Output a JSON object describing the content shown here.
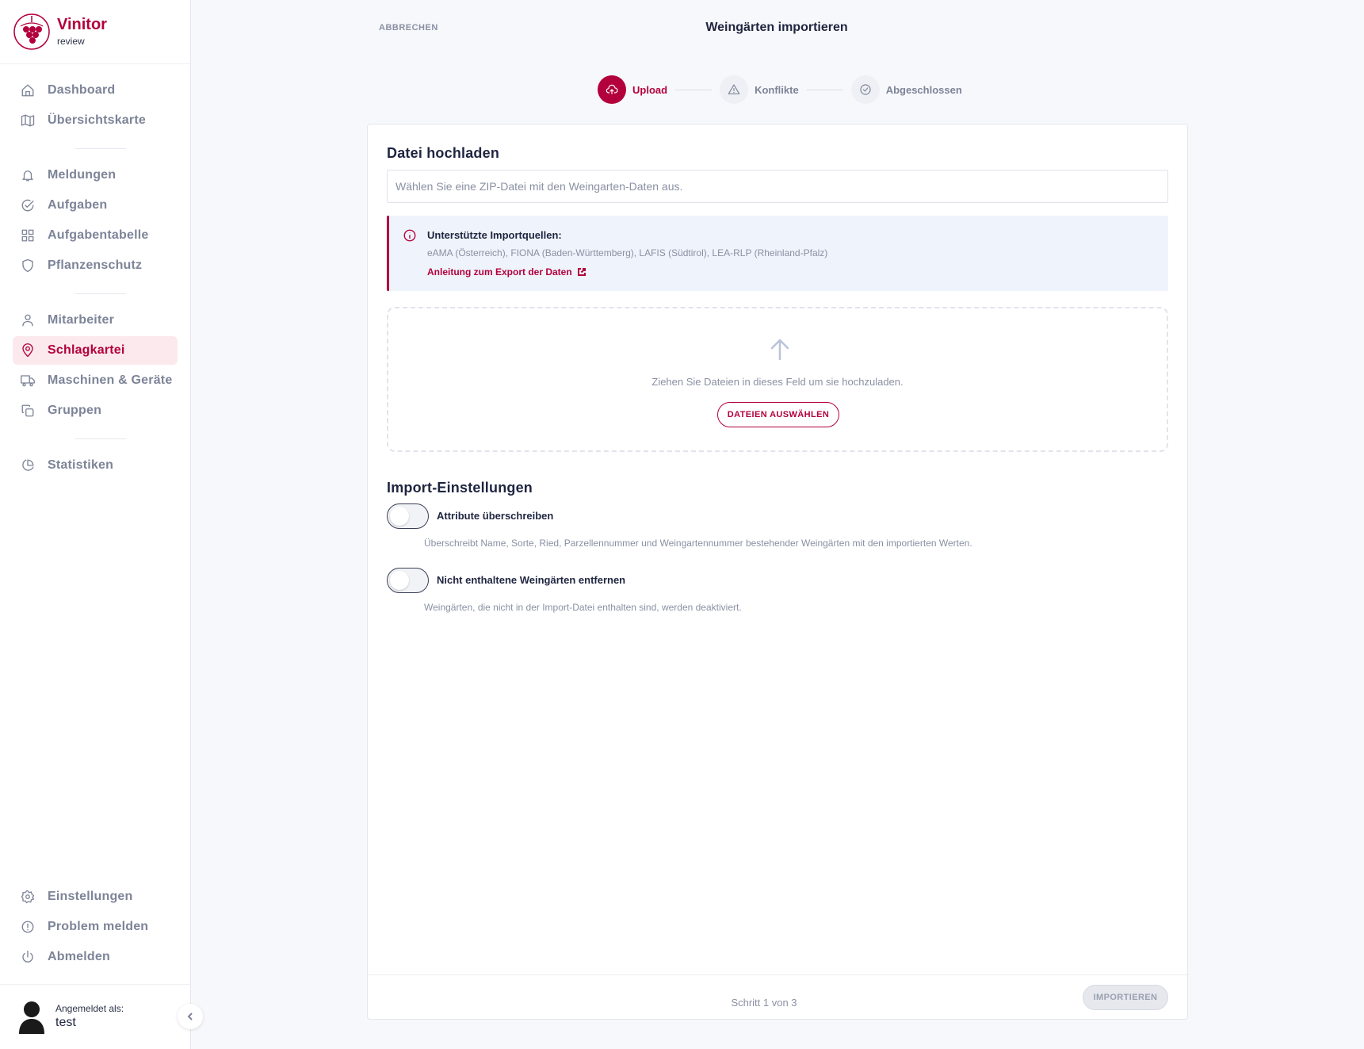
{
  "brand": {
    "name": "Vinitor",
    "subtitle": "review",
    "color": "#b3003c"
  },
  "sidebar": {
    "items": [
      {
        "label": "Dashboard",
        "icon": "home-icon"
      },
      {
        "label": "Übersichtskarte",
        "icon": "map-icon"
      },
      {
        "label": "Meldungen",
        "icon": "bell-icon"
      },
      {
        "label": "Aufgaben",
        "icon": "check-circle-icon"
      },
      {
        "label": "Aufgabentabelle",
        "icon": "grid-icon"
      },
      {
        "label": "Pflanzenschutz",
        "icon": "shield-icon"
      },
      {
        "label": "Mitarbeiter",
        "icon": "user-icon"
      },
      {
        "label": "Schlagkartei",
        "icon": "map-pin-icon",
        "active": true
      },
      {
        "label": "Maschinen & Geräte",
        "icon": "truck-icon"
      },
      {
        "label": "Gruppen",
        "icon": "copy-icon"
      },
      {
        "label": "Statistiken",
        "icon": "pie-chart-icon"
      }
    ],
    "bottom_items": [
      {
        "label": "Einstellungen",
        "icon": "gear-icon"
      },
      {
        "label": "Problem melden",
        "icon": "alert-circle-icon"
      },
      {
        "label": "Abmelden",
        "icon": "power-icon"
      }
    ],
    "user": {
      "logged_in_label": "Angemeldet als:",
      "username": "test"
    }
  },
  "header": {
    "cancel_label": "ABBRECHEN",
    "title": "Weingärten importieren"
  },
  "stepper": {
    "steps": [
      {
        "label": "Upload",
        "icon": "upload-cloud-icon",
        "active": true
      },
      {
        "label": "Konflikte",
        "icon": "warning-icon",
        "active": false
      },
      {
        "label": "Abgeschlossen",
        "icon": "check-circle-icon",
        "active": false
      }
    ]
  },
  "upload": {
    "heading": "Datei hochladen",
    "file_placeholder": "Wählen Sie eine ZIP-Datei mit den Weingarten-Daten aus.",
    "info": {
      "title": "Unterstützte Importquellen:",
      "sources": "eAMA (Österreich), FIONA (Baden-Württemberg), LAFIS (Südtirol), LEA-RLP (Rheinland-Pfalz)",
      "link": "Anleitung zum Export der Daten"
    },
    "dropzone": {
      "text": "Ziehen Sie Dateien in dieses Feld um sie hochzuladen.",
      "button": "DATEIEN AUSWÄHLEN"
    }
  },
  "settings": {
    "heading": "Import-Einstellungen",
    "toggles": [
      {
        "label": "Attribute überschreiben",
        "description": "Überschreibt Name, Sorte, Ried, Parzellennummer und Weingartennummer bestehender Weingärten mit den importierten Werten.",
        "on": false
      },
      {
        "label": "Nicht enthaltene Weingärten entfernen",
        "description": "Weingärten, die nicht in der Import-Datei enthalten sind, werden deaktiviert.",
        "on": false
      }
    ]
  },
  "footer": {
    "step_text": "Schritt 1 von 3",
    "import_button": "IMPORTIEREN"
  }
}
